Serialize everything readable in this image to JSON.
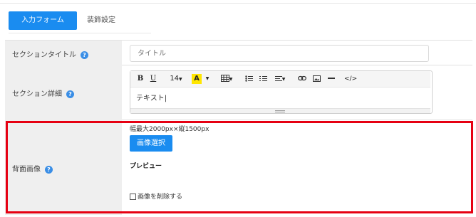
{
  "tabs": {
    "active_label": "入力フォーム",
    "other_label": "装飾設定"
  },
  "rows": {
    "title": {
      "label": "セクションタイトル",
      "input_value": "タイトル"
    },
    "detail": {
      "label": "セクション詳細",
      "font_size": "14",
      "text": "テキスト|"
    },
    "bg_image": {
      "label": "背面画像",
      "size_note": "幅最大2000px×縦1500px",
      "select_button": "画像選択",
      "preview_label": "プレビュー",
      "delete_label": "画像を削除する"
    }
  },
  "help_glyph": "?",
  "toolbar": {
    "bold": "B",
    "underline": "U",
    "font_color": "A",
    "code": "</>"
  },
  "colors": {
    "accent": "#1a8cf0",
    "highlight_border": "#e60012",
    "label_bg": "#efefef"
  }
}
